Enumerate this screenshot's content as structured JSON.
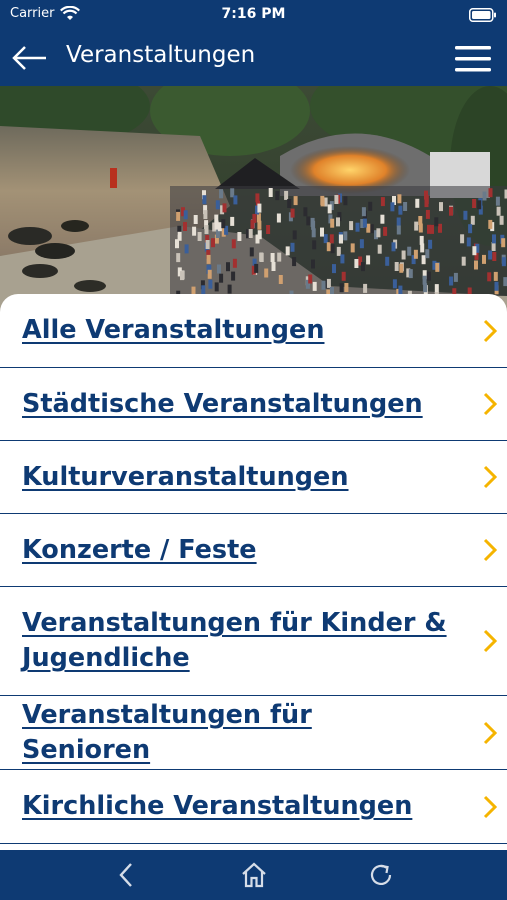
{
  "status": {
    "carrier": "Carrier",
    "time": "7:16 PM"
  },
  "nav": {
    "title": "Veranstaltungen"
  },
  "icons": {
    "back": "arrow-left-icon",
    "menu": "hamburger-menu-icon",
    "chevron": "chevron-right-icon",
    "bottom_back": "chevron-left-icon",
    "home": "home-icon",
    "reload": "reload-icon"
  },
  "colors": {
    "primary": "#0e3a73",
    "accent": "#f5b400"
  },
  "menu": {
    "items": [
      {
        "label": "Alle Veranstaltungen"
      },
      {
        "label": "Städtische Veranstaltungen"
      },
      {
        "label": "Kulturveranstaltungen"
      },
      {
        "label": "Konzerte / Feste"
      },
      {
        "label": "Veranstaltungen für Kinder & Jugendliche"
      },
      {
        "label": "Veranstaltungen für Senioren"
      },
      {
        "label": "Kirchliche Veranstaltungen"
      }
    ]
  }
}
